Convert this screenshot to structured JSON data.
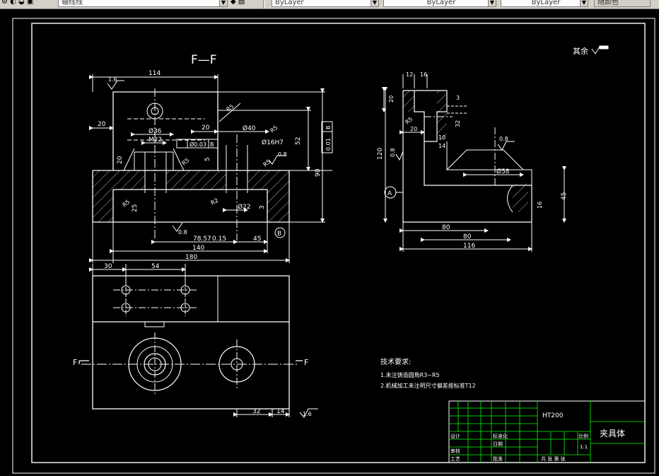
{
  "toolbar": {
    "layer_name": "轴线线",
    "color_value": "ByLayer",
    "linetype_value": "ByLayer",
    "lineweight_value": "ByLayer",
    "plotstyle_value": "随颜色"
  },
  "drawing": {
    "section_label": "F—F",
    "roughness_note": "其余",
    "view_marker_left": "F",
    "view_marker_right": "F",
    "datum_a": "A",
    "datum_b": "B",
    "front_dims": {
      "d114": "114",
      "r16a": "1.6",
      "r5": "R5",
      "d20a": "20",
      "d20b": "20",
      "phi36": "Ø36",
      "phi40": "Ø40",
      "m22": "M22",
      "phi003": "Ø0.03",
      "phi16h7": "Ø16H7",
      "r5b": "R5",
      "r5c": "R5",
      "r5d": "R5",
      "r08a": "0.8",
      "d52": "52",
      "tol001": "0.01",
      "d90": "90",
      "d20c": "20",
      "d5": "5",
      "d25": "25",
      "r2": "R2",
      "phi22": "Ø22",
      "d3": "3",
      "r08b": "0.8",
      "d78": "78.57",
      "d015": "0.15",
      "d45": "45",
      "d140": "140",
      "d180": "180"
    },
    "side_dims": {
      "d12": "12",
      "d16": "16",
      "d20v": "20",
      "d3": "3",
      "r5": "R5",
      "d20h": "20",
      "d10": "10",
      "d14": "14",
      "d32": "32",
      "d120": "120",
      "r08a": "0.8",
      "r08b": "0.8",
      "phi58": "Ø58",
      "d45": "45",
      "d16v": "16",
      "d80a": "80",
      "d80b": "80",
      "d116": "116"
    },
    "top_dims": {
      "d30": "30",
      "d54": "54",
      "d32": "32",
      "d14": "14",
      "r16": "1.6"
    },
    "tech_title": "技术要求:",
    "tech_notes": [
      "1.未注铸造圆角R3~R5",
      "2.机械加工未注明尺寸偏差按标准T12"
    ],
    "title_block": {
      "material": "HT200",
      "part_name": "夹具体",
      "design": "设计",
      "review": "审核",
      "process": "工艺",
      "standardize": "标准化",
      "date": "日期",
      "approve": "批准",
      "scale_label": "比例",
      "scale_value": "1:1",
      "sheets": "共 张 第 张"
    }
  }
}
